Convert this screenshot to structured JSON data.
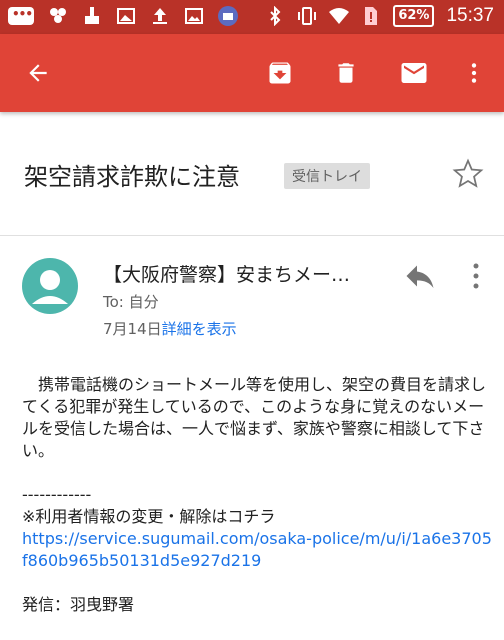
{
  "status_bar": {
    "battery": "62%",
    "time": "15:37",
    "icons": [
      "chat-bubble-icon",
      "hexagon-icon",
      "broom-icon",
      "image-card-icon",
      "upload-icon",
      "gallery-icon",
      "camera-badge-icon",
      "bluetooth-icon",
      "vibrate-icon",
      "wifi-icon",
      "sim-alert-icon"
    ]
  },
  "app_bar": {
    "icons": [
      "back-arrow-icon",
      "archive-icon",
      "trash-icon",
      "mail-icon",
      "more-vert-icon"
    ],
    "color": "#e04437"
  },
  "email": {
    "subject": "架空請求詐欺に注意",
    "label": "受信トレイ",
    "sender": "【大阪府警察】安まちメー…",
    "to": "To: 自分",
    "date": "7月14日",
    "details_link": "詳細を表示",
    "body_paragraph": "携帯電話機のショートメール等を使用し、架空の費目を請求してくる犯罪が発生しているので、このような身に覚えのないメールを受信した場合は、一人で悩まず、家族や警察に相談して下さい。",
    "separator": "------------",
    "unsubscribe_text": "※利用者情報の変更・解除はコチラ",
    "unsubscribe_url": "https://service.sugumail.com/osaka-police/m/u/i/1a6e3705f860b965b50131d5e927d219",
    "from_line": "発信：羽曳野署"
  },
  "colors": {
    "status_bar": "#b93228",
    "link": "#1a73e8",
    "avatar": "#4db6ac"
  }
}
